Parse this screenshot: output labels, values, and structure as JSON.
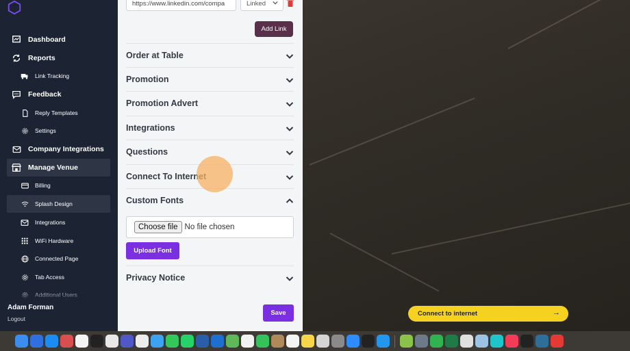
{
  "sidebar": {
    "items": [
      {
        "label": "Dashboard",
        "icon": "dashboard-icon",
        "level": "top",
        "active": false
      },
      {
        "label": "Reports",
        "icon": "refresh-icon",
        "level": "top",
        "active": false
      },
      {
        "label": "Link Tracking",
        "icon": "truck-icon",
        "level": "sub",
        "active": false
      },
      {
        "label": "Feedback",
        "icon": "chat-icon",
        "level": "top",
        "active": false
      },
      {
        "label": "Reply Templates",
        "icon": "document-icon",
        "level": "sub",
        "active": false
      },
      {
        "label": "Settings",
        "icon": "gear-icon",
        "level": "sub",
        "active": false
      },
      {
        "label": "Company Integrations",
        "icon": "mail-icon",
        "level": "top",
        "active": false
      },
      {
        "label": "Manage Venue",
        "icon": "store-icon",
        "level": "top",
        "active": true
      },
      {
        "label": "Billing",
        "icon": "card-icon",
        "level": "sub",
        "active": false
      },
      {
        "label": "Splash Design",
        "icon": "wifi-icon",
        "level": "sub",
        "active": true
      },
      {
        "label": "Integrations",
        "icon": "mail-icon",
        "level": "sub",
        "active": false
      },
      {
        "label": "WiFi Hardware",
        "icon": "grid-icon",
        "level": "sub",
        "active": false
      },
      {
        "label": "Connected Page",
        "icon": "globe-icon",
        "level": "sub",
        "active": false
      },
      {
        "label": "Tab Access",
        "icon": "gear-icon",
        "level": "sub",
        "active": false
      },
      {
        "label": "Additional Users",
        "icon": "gear-icon",
        "level": "sub",
        "active": false
      }
    ],
    "user_name": "Adam Forman",
    "logout_label": "Logout"
  },
  "links": {
    "url_value": "https://www.linkedin.com/compa",
    "type_value": "Linked",
    "add_link_label": "Add Link"
  },
  "sections": [
    {
      "label": "Order at Table",
      "expanded": false
    },
    {
      "label": "Promotion",
      "expanded": false
    },
    {
      "label": "Promotion Advert",
      "expanded": false
    },
    {
      "label": "Integrations",
      "expanded": false
    },
    {
      "label": "Questions",
      "expanded": false
    },
    {
      "label": "Connect To Internet",
      "expanded": false
    },
    {
      "label": "Custom Fonts",
      "expanded": true
    },
    {
      "label": "Privacy Notice",
      "expanded": false
    }
  ],
  "custom_fonts": {
    "choose_file_label": "Choose file",
    "no_file_text": "No file chosen",
    "upload_label": "Upload Font"
  },
  "save_label": "Save",
  "preview": {
    "connect_label": "Connect to internet",
    "arrow": "→"
  },
  "colors": {
    "sidebar_bg": "#1c2333",
    "accent_purple": "#7a2fe0",
    "add_link_bg": "#5a2f4a",
    "connect_yellow": "#f5d21f"
  },
  "dock": {
    "apps": [
      {
        "name": "finder-icon",
        "color": "#3b8ef0"
      },
      {
        "name": "mail-icon",
        "color": "#2f6fe0"
      },
      {
        "name": "appstore-icon",
        "color": "#1b8cf2"
      },
      {
        "name": "launchpad-icon",
        "color": "#d94f4f"
      },
      {
        "name": "calendar-icon",
        "color": "#f4f4f4"
      },
      {
        "name": "clock-icon",
        "color": "#222222"
      },
      {
        "name": "slack-icon",
        "color": "#e8e8e8"
      },
      {
        "name": "teams-icon",
        "color": "#5058c8"
      },
      {
        "name": "chrome-icon",
        "color": "#ececec"
      },
      {
        "name": "safari-icon",
        "color": "#3da2f0"
      },
      {
        "name": "messages-icon",
        "color": "#34c759"
      },
      {
        "name": "whatsapp-icon",
        "color": "#25d366"
      },
      {
        "name": "word-icon",
        "color": "#2b5ea8"
      },
      {
        "name": "outlook-icon",
        "color": "#1f6fd1"
      },
      {
        "name": "maps-icon",
        "color": "#5fb85a"
      },
      {
        "name": "photos-icon",
        "color": "#f2f2f2"
      },
      {
        "name": "facetime-icon",
        "color": "#36c25a"
      },
      {
        "name": "contacts-icon",
        "color": "#b08a5a"
      },
      {
        "name": "reminders-icon",
        "color": "#f4f4f4"
      },
      {
        "name": "notes-icon",
        "color": "#f7d64a"
      },
      {
        "name": "script-icon",
        "color": "#d5d5d5"
      },
      {
        "name": "settings-icon",
        "color": "#8a8a8a"
      },
      {
        "name": "zoom-icon",
        "color": "#2d8cff"
      },
      {
        "name": "bolt-icon",
        "color": "#222222"
      },
      {
        "name": "docker-icon",
        "color": "#2396ed"
      },
      {
        "name": "w-icon",
        "color": "#8bc34a"
      },
      {
        "name": "preview-icon",
        "color": "#6c7a8a"
      },
      {
        "name": "numbers-icon",
        "color": "#2fb24f"
      },
      {
        "name": "excel-icon",
        "color": "#1f7a45"
      },
      {
        "name": "shortcuts-icon",
        "color": "#e0e0e0"
      },
      {
        "name": "keychain-icon",
        "color": "#9cc3e6"
      },
      {
        "name": "canva-icon",
        "color": "#20c4cb"
      },
      {
        "name": "music-icon",
        "color": "#f23c58"
      },
      {
        "name": "terminal-icon",
        "color": "#222222"
      },
      {
        "name": "quicktime-icon",
        "color": "#2e6f9a"
      },
      {
        "name": "toggle-icon",
        "color": "#e53935"
      }
    ]
  }
}
